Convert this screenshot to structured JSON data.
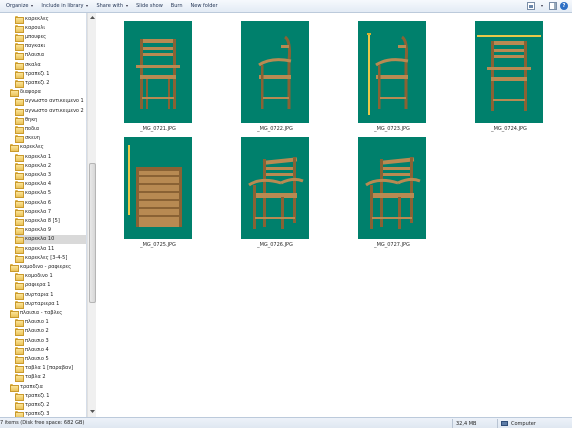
{
  "toolbar": {
    "organize": "Organize",
    "include_in_library": "Include in library",
    "share_with": "Share with",
    "slide_show": "Slide show",
    "burn": "Burn",
    "new_folder": "New folder"
  },
  "nav": {
    "items": [
      {
        "label": "καρεκλες",
        "level": 1
      },
      {
        "label": "καρουλι",
        "level": 1
      },
      {
        "label": "μπουφες",
        "level": 1
      },
      {
        "label": "παγκακι",
        "level": 1
      },
      {
        "label": "πλαισια",
        "level": 1
      },
      {
        "label": "σκαλα",
        "level": 1
      },
      {
        "label": "τραπεζι 1",
        "level": 1
      },
      {
        "label": "τραπεζι 2",
        "level": 1
      },
      {
        "label": "διαφορα",
        "level": 0
      },
      {
        "label": "αγνωστο αντικειμενο 1",
        "level": 1
      },
      {
        "label": "αγνωστο αντικειμενο 2",
        "level": 1
      },
      {
        "label": "θηκη",
        "level": 1
      },
      {
        "label": "ποδια",
        "level": 1
      },
      {
        "label": "σκευη",
        "level": 1
      },
      {
        "label": "καρεκλες",
        "level": 0
      },
      {
        "label": "καρεκλα 1",
        "level": 1
      },
      {
        "label": "καρεκλα 2",
        "level": 1
      },
      {
        "label": "καρεκλα 3",
        "level": 1
      },
      {
        "label": "καρεκλα 4",
        "level": 1
      },
      {
        "label": "καρεκλα 5",
        "level": 1
      },
      {
        "label": "καρεκλα 6",
        "level": 1
      },
      {
        "label": "καρεκλα 7",
        "level": 1
      },
      {
        "label": "καρεκλα 8 [5]",
        "level": 1
      },
      {
        "label": "καρεκλα 9",
        "level": 1
      },
      {
        "label": "καρεκλα 10",
        "level": 1,
        "selected": true
      },
      {
        "label": "καρεκλα 11",
        "level": 1
      },
      {
        "label": "καρεκλες [3-4-5]",
        "level": 1
      },
      {
        "label": "καμοδινο - ραφιερες",
        "level": 0
      },
      {
        "label": "κομοδινο 1",
        "level": 1
      },
      {
        "label": "ραφιερα 1",
        "level": 1
      },
      {
        "label": "συρταρια 1",
        "level": 1
      },
      {
        "label": "συρταριερα 1",
        "level": 1
      },
      {
        "label": "πλαισια - ταβλες",
        "level": 0
      },
      {
        "label": "πλαισιο 1",
        "level": 1
      },
      {
        "label": "πλαισιο 2",
        "level": 1
      },
      {
        "label": "πλαισιο 3",
        "level": 1
      },
      {
        "label": "πλαισιο 4",
        "level": 1
      },
      {
        "label": "πλαισιο 5",
        "level": 1
      },
      {
        "label": "ταβλα 1 [παραβαν]",
        "level": 1
      },
      {
        "label": "ταβλα 2",
        "level": 1
      },
      {
        "label": "τραπεζια",
        "level": 0
      },
      {
        "label": "τραπεζι 1",
        "level": 1
      },
      {
        "label": "τραπεζι 2",
        "level": 1
      },
      {
        "label": "τραπεζι 3",
        "level": 1
      }
    ]
  },
  "files": [
    {
      "name": "_MG_0721.JPG",
      "view": "front"
    },
    {
      "name": "_MG_0722.JPG",
      "view": "side"
    },
    {
      "name": "_MG_0723.JPG",
      "view": "side-ruler"
    },
    {
      "name": "_MG_0724.JPG",
      "view": "back-ruler"
    },
    {
      "name": "_MG_0725.JPG",
      "view": "seat-ruler"
    },
    {
      "name": "_MG_0726.JPG",
      "view": "angle"
    },
    {
      "name": "_MG_0727.JPG",
      "view": "angle2"
    }
  ],
  "status": {
    "items": "7 items (Disk free space: 682 GB)",
    "size": "32,4 MB",
    "location": "Computer"
  },
  "colors": {
    "thumb_bg": "#00806c",
    "wood": "#b88a52",
    "wood_dark": "#8a6234"
  }
}
